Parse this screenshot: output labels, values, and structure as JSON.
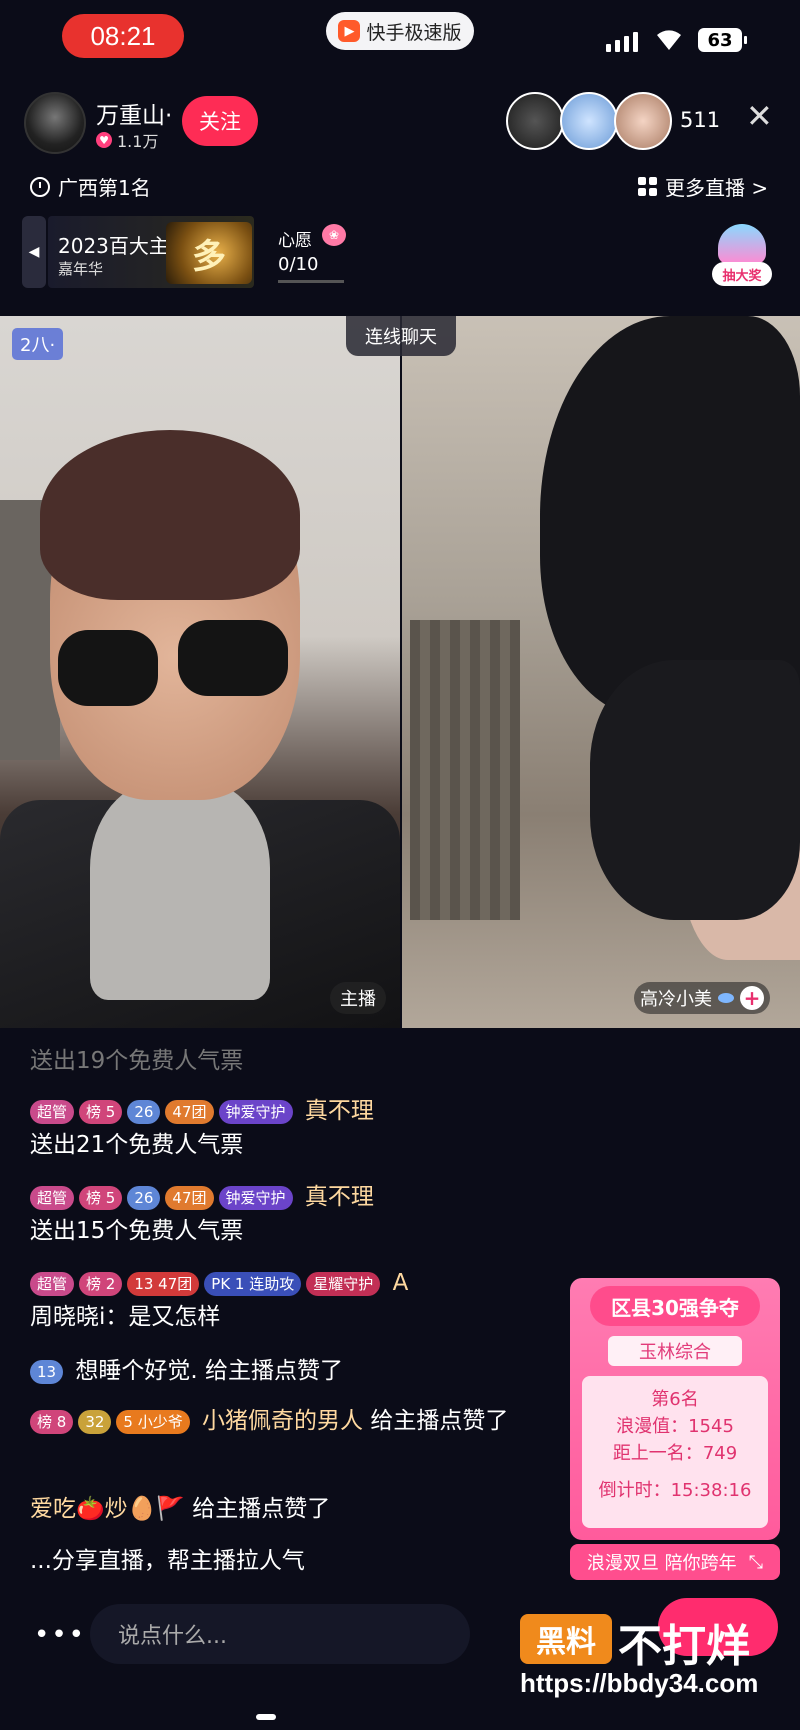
{
  "status_bar": {
    "time": "08:21",
    "app_name": "快手极速版",
    "battery": "63"
  },
  "header": {
    "host_name": "万重山·",
    "host_likes": "1.1万",
    "follow_label": "关注",
    "viewer_count": "511",
    "region_rank": "广西第1名",
    "more_live": "更多直播 >"
  },
  "banner": {
    "title": "2023百大主播",
    "subtitle": "嘉年华",
    "art_char": "多",
    "wish_label": "心愿",
    "wish_progress": "0/10",
    "lottery_label": "抽大奖"
  },
  "video": {
    "live_id": "2八·",
    "link_chat": "连线聊天",
    "host_tag": "主播",
    "guest_name": "高冷小美"
  },
  "comments": [
    {
      "text": "送出19个免费人气票"
    },
    {
      "badges": [
        "超管",
        "榜 5",
        "26",
        "47团",
        "钟爱守护"
      ],
      "user": "真不理",
      "text": "送出21个免费人气票"
    },
    {
      "badges": [
        "超管",
        "榜 5",
        "26",
        "47团",
        "钟爱守护"
      ],
      "user": "真不理",
      "text": "送出15个免费人气票"
    },
    {
      "badges": [
        "超管",
        "榜 2",
        "13 47团",
        "PK 1 连助攻",
        "星耀守护"
      ],
      "user": "A",
      "text": "周晓晓i：是又怎样"
    },
    {
      "badges": [
        "13"
      ],
      "text": "想睡个好觉. 给主播点赞了"
    },
    {
      "badges": [
        "榜 8",
        "32",
        "5 小少爷"
      ],
      "user": "小猪佩奇的男人",
      "text": "给主播点赞了"
    },
    {
      "user": "爱吃🍅炒🥚🚩",
      "text": "给主播点赞了"
    },
    {
      "text": "...分享直播，帮主播拉人气"
    }
  ],
  "rank_card": {
    "title": "区县30强争夺",
    "region": "玉林综合",
    "rank": "第6名",
    "romance_label": "浪漫值：",
    "romance_value": "1545",
    "gap_label": "距上一名：",
    "gap_value": "749",
    "countdown_label": "倒计时：",
    "countdown_value": "15:38:16",
    "footer": "浪漫双旦 陪你跨年"
  },
  "bottom": {
    "more": "•••",
    "input_placeholder": "说点什么..."
  },
  "watermark": {
    "logo": "黑料",
    "text": "不打烊",
    "url": "https://bbdy34.com"
  }
}
